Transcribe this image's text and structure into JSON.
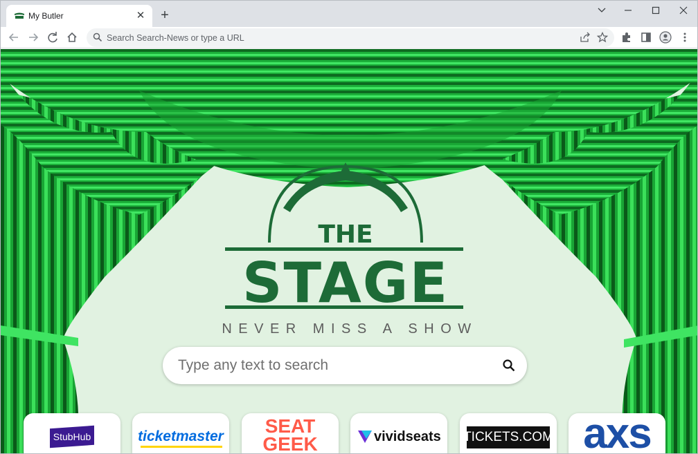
{
  "browser": {
    "tab_title": "My Butler",
    "tab_close": "✕",
    "new_tab": "+",
    "controls": {
      "minimize": "—",
      "maximize": "☐",
      "close": "✕"
    },
    "omnibox_placeholder": "Search Search-News or type a URL"
  },
  "page": {
    "logo": {
      "line1": "THE",
      "line2": "STAGE"
    },
    "tagline": "NEVER MISS A SHOW",
    "search_placeholder": "Type any text to search",
    "tiles": [
      {
        "label": "StubHub"
      },
      {
        "label": "ticketmaster"
      },
      {
        "label": "SEAT GEEK"
      },
      {
        "label": "vividseats"
      },
      {
        "label": "TICKETS.COM"
      },
      {
        "label": "axs"
      }
    ]
  },
  "colors": {
    "curtain": "#1fb33c",
    "curtain_dark": "#0b5e1c",
    "logo_green": "#1d6b37",
    "stubhub": "#3b1a91",
    "ticketmaster": "#026cdf",
    "seatgeek": "#ff5b49",
    "axs": "#1d4fa6"
  }
}
